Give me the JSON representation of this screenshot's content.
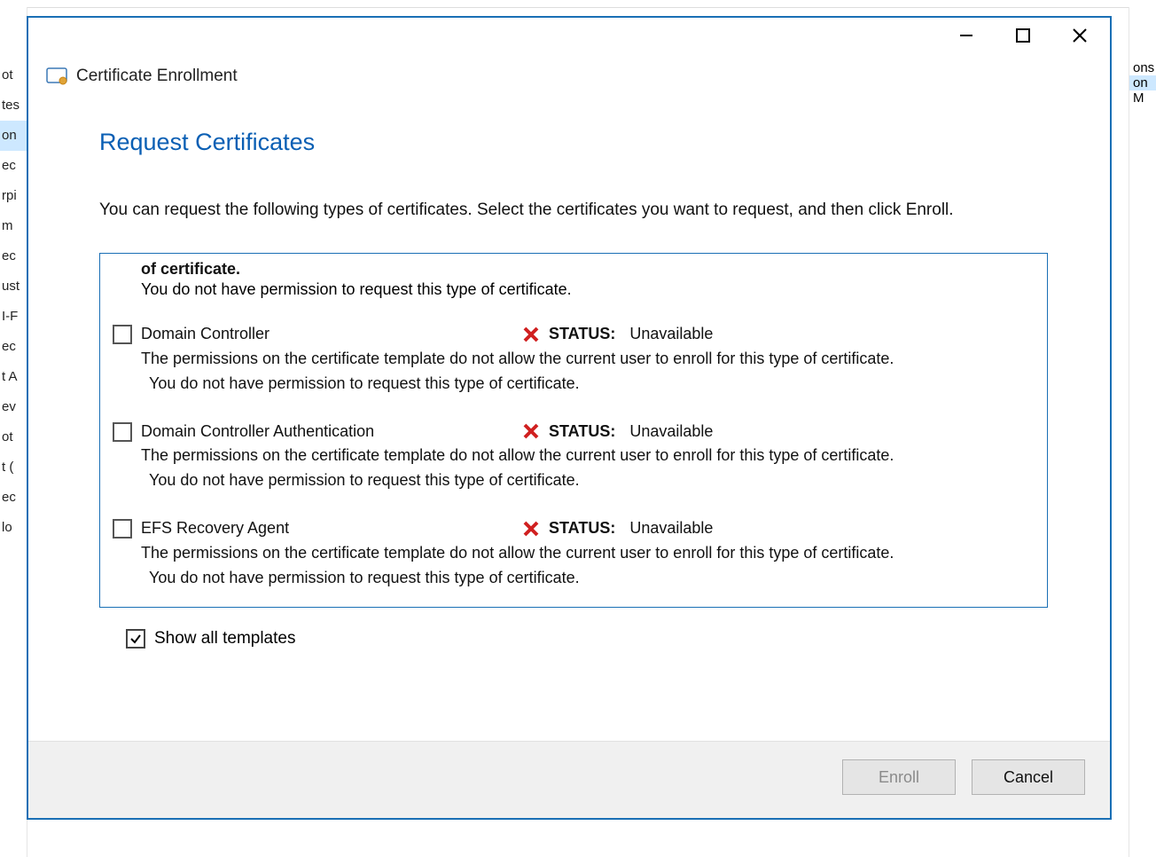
{
  "dialog": {
    "title": "Certificate Enrollment",
    "heading": "Request Certificates",
    "instructions": "You can request the following types of certificates. Select the certificates you want to request, and then click Enroll.",
    "show_all_label": "Show all templates",
    "show_all_checked": true
  },
  "partial_first": {
    "line1": "of certificate.",
    "line2": "You do not have permission to request this type of certificate."
  },
  "templates": [
    {
      "name": "Domain Controller",
      "status_label": "STATUS:",
      "status_value": "Unavailable",
      "reason1": "The permissions on the certificate template do not allow the current user to enroll for this type of certificate.",
      "reason2": "You do not have permission to request this type of certificate."
    },
    {
      "name": "Domain Controller Authentication",
      "status_label": "STATUS:",
      "status_value": "Unavailable",
      "reason1": "The permissions on the certificate template do not allow the current user to enroll for this type of certificate.",
      "reason2": "You do not have permission to request this type of certificate."
    },
    {
      "name": "EFS Recovery Agent",
      "status_label": "STATUS:",
      "status_value": "Unavailable",
      "reason1": "The permissions on the certificate template do not allow the current user to enroll for this type of certificate.",
      "reason2": "You do not have permission to request this type of certificate."
    }
  ],
  "buttons": {
    "enroll": "Enroll",
    "cancel": "Cancel"
  },
  "bg_left": [
    "ot",
    "tes",
    "on",
    "ec",
    "rpi",
    "m",
    "ec",
    "ust",
    "I-F",
    "ec",
    "t A",
    "ev",
    "ot",
    "t (",
    "ec",
    "lo"
  ],
  "bg_right": [
    "ons",
    "on",
    "M"
  ]
}
